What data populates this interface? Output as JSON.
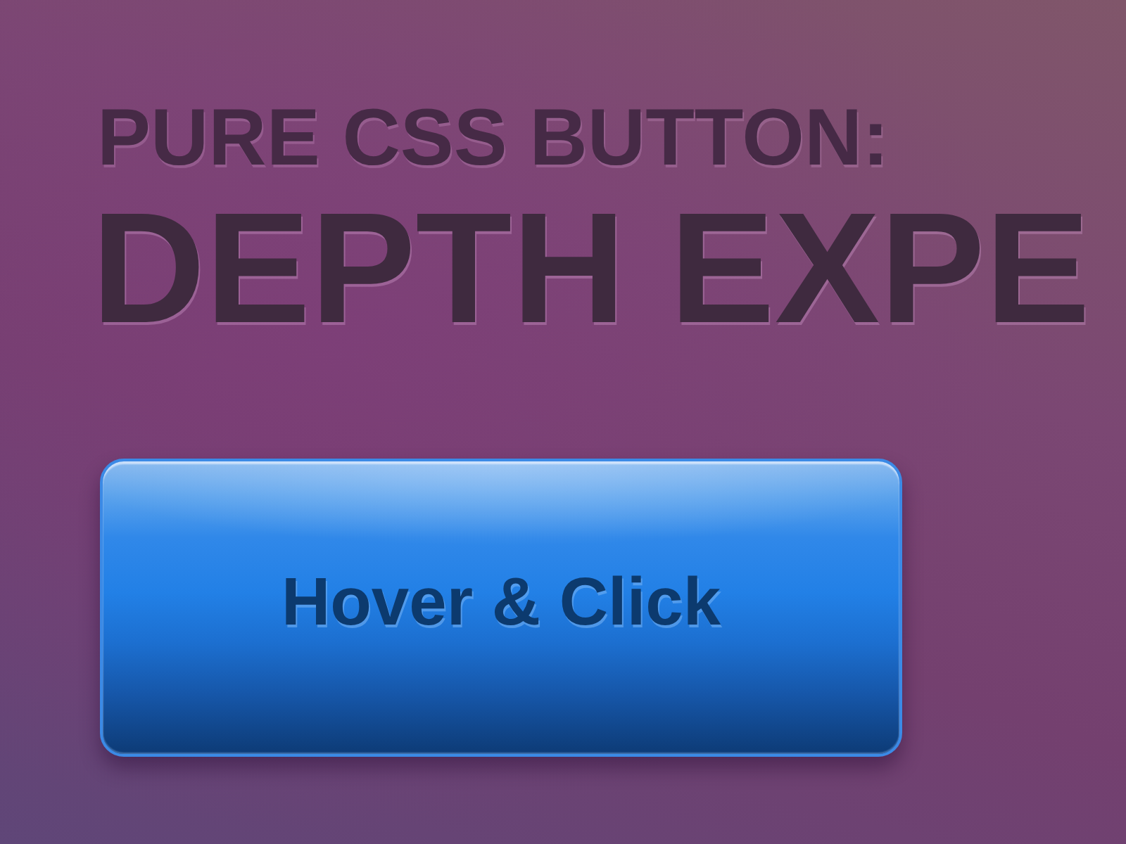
{
  "heading": {
    "subtitle": "PURE CSS BUTTON:",
    "title": "DEPTH EXPE"
  },
  "button": {
    "label": "Hover & Click"
  }
}
